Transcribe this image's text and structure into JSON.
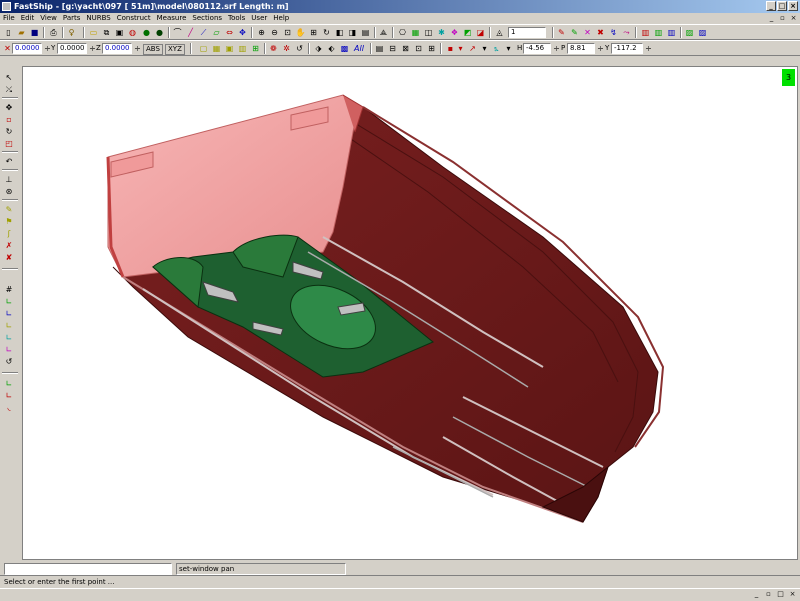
{
  "window": {
    "title": "FastShip - [g:\\yacht\\097 [            51m]\\model\\080112.srf       Length: m]"
  },
  "menu": [
    "File",
    "Edit",
    "View",
    "Parts",
    "NURBS",
    "Construct",
    "Measure",
    "Sections",
    "Tools",
    "User",
    "Help"
  ],
  "toolbar": {
    "layer_value": "1",
    "x_label": "X",
    "x_value": "0.0000",
    "y_label": "Y",
    "y_value": "0.0000",
    "z_label": "Z",
    "z_value": "0.0000",
    "abs_label": "ABS",
    "xyz_label": "XYZ",
    "h_label": "H",
    "h_value": "-4.56",
    "p_label": "P",
    "p_value": "8.81",
    "yaw_label": "Y",
    "yaw_value": "-117.2"
  },
  "view_badge": "3",
  "command": {
    "prompt_text": "set-window pan",
    "status_text": "Select or enter the first point ..."
  },
  "colors": {
    "hull": "#6b1a1a",
    "deck": "#f0a0a0",
    "tunnel": "#1a5a2a",
    "accent_green": "#00e000"
  }
}
